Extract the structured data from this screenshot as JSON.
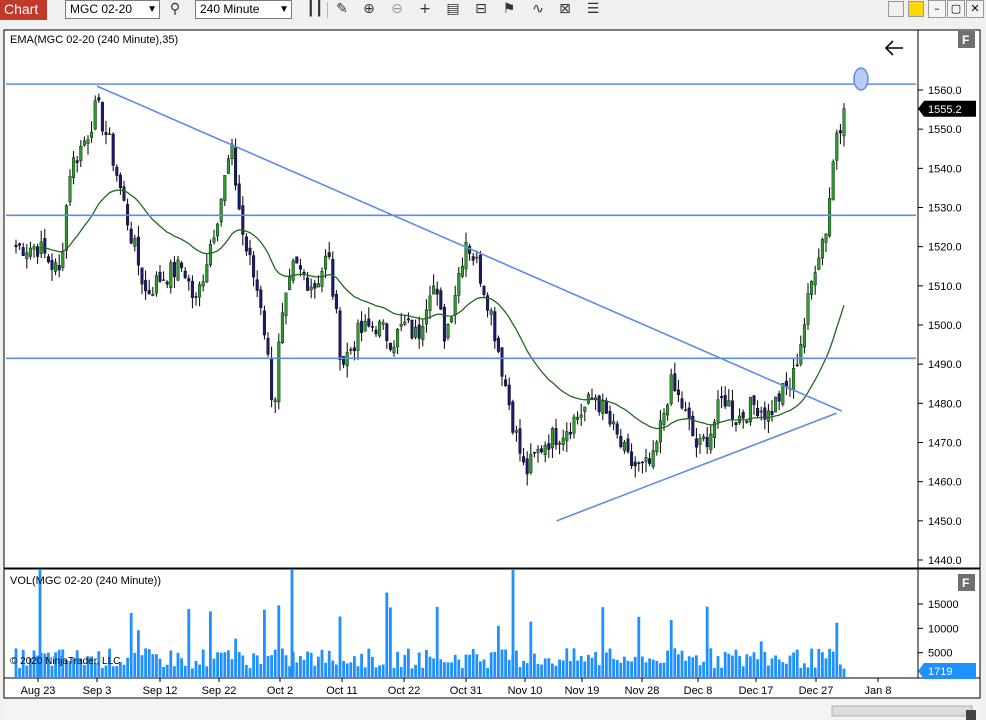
{
  "toolbar": {
    "tab_label": "Chart",
    "instrument": "MGC 02-20",
    "interval": "240 Minute",
    "icons": [
      "magnifier-icon",
      "bar-type-icon",
      "pencil-icon",
      "zoom-in-icon",
      "zoom-out-icon",
      "crosshair-icon",
      "properties-icon",
      "data-box-icon",
      "strategy-icon",
      "indicators-icon",
      "list-icon"
    ]
  },
  "window": {
    "swatches": [
      "#f0f0f0",
      "#ffd700"
    ],
    "buttons": [
      "–",
      "▢",
      "✕"
    ]
  },
  "price_panel": {
    "indicator_label": "EMA(MGC 02-20 (240 Minute),35)",
    "y_ticks": [
      "1560.0",
      "1550.0",
      "1540.0",
      "1530.0",
      "1520.0",
      "1510.0",
      "1500.0",
      "1490.0",
      "1480.0",
      "1470.0",
      "1460.0",
      "1450.0",
      "1440.0"
    ],
    "last_price": "1555.2",
    "panel_button": "F",
    "colors": {
      "line": "#5b8de8",
      "ema": "#1e6b1e",
      "up": "#2aa02a",
      "down": "#1a1a6e",
      "last_price_bg": "#000000"
    }
  },
  "volume_panel": {
    "indicator_label": "VOL(MGC 02-20 (240 Minute))",
    "y_ticks": [
      "15000",
      "10000",
      "5000"
    ],
    "last_volume": "1719",
    "panel_button": "F",
    "copyright": "© 2020 NinjaTrader, LLC",
    "bar_color": "#1e90ff"
  },
  "x_axis": {
    "labels": [
      "Aug 23",
      "Sep 3",
      "Sep 12",
      "Sep 22",
      "Oct 2",
      "Oct 11",
      "Oct 22",
      "Oct 31",
      "Nov 10",
      "Nov 19",
      "Nov 28",
      "Dec 8",
      "Dec 17",
      "Dec 27",
      "Jan 8"
    ]
  },
  "chart_data": {
    "type": "candlestick",
    "x": [
      "Aug 23",
      "Sep 3",
      "Sep 12",
      "Sep 22",
      "Oct 2",
      "Oct 11",
      "Oct 22",
      "Oct 31",
      "Nov 10",
      "Nov 19",
      "Nov 28",
      "Dec 8",
      "Dec 17",
      "Dec 27",
      "Jan 8"
    ],
    "close_path": [
      {
        "x": "Aug 23",
        "y": 1520
      },
      {
        "x": "Aug 27",
        "y": 1513
      },
      {
        "x": "Aug 29",
        "y": 1540
      },
      {
        "x": "Sep 1",
        "y": 1548
      },
      {
        "x": "Sep 3",
        "y": 1556
      },
      {
        "x": "Sep 5",
        "y": 1545
      },
      {
        "x": "Sep 8",
        "y": 1522
      },
      {
        "x": "Sep 10",
        "y": 1508
      },
      {
        "x": "Sep 12",
        "y": 1512
      },
      {
        "x": "Sep 16",
        "y": 1515
      },
      {
        "x": "Sep 18",
        "y": 1505
      },
      {
        "x": "Sep 22",
        "y": 1530
      },
      {
        "x": "Sep 24",
        "y": 1545
      },
      {
        "x": "Sep 26",
        "y": 1522
      },
      {
        "x": "Sep 29",
        "y": 1505
      },
      {
        "x": "Oct 1",
        "y": 1478
      },
      {
        "x": "Oct 2",
        "y": 1498
      },
      {
        "x": "Oct 4",
        "y": 1515
      },
      {
        "x": "Oct 7",
        "y": 1510
      },
      {
        "x": "Oct 9",
        "y": 1518
      },
      {
        "x": "Oct 11",
        "y": 1490
      },
      {
        "x": "Oct 14",
        "y": 1498
      },
      {
        "x": "Oct 17",
        "y": 1500
      },
      {
        "x": "Oct 20",
        "y": 1496
      },
      {
        "x": "Oct 22",
        "y": 1500
      },
      {
        "x": "Oct 24",
        "y": 1497
      },
      {
        "x": "Oct 26",
        "y": 1512
      },
      {
        "x": "Oct 28",
        "y": 1497
      },
      {
        "x": "Oct 31",
        "y": 1522
      },
      {
        "x": "Nov 2",
        "y": 1515
      },
      {
        "x": "Nov 4",
        "y": 1505
      },
      {
        "x": "Nov 6",
        "y": 1490
      },
      {
        "x": "Nov 8",
        "y": 1475
      },
      {
        "x": "Nov 10",
        "y": 1462
      },
      {
        "x": "Nov 13",
        "y": 1470
      },
      {
        "x": "Nov 16",
        "y": 1473
      },
      {
        "x": "Nov 19",
        "y": 1478
      },
      {
        "x": "Nov 21",
        "y": 1482
      },
      {
        "x": "Nov 24",
        "y": 1472
      },
      {
        "x": "Nov 26",
        "y": 1465
      },
      {
        "x": "Nov 28",
        "y": 1463
      },
      {
        "x": "Nov 30",
        "y": 1465
      },
      {
        "x": "Dec 3",
        "y": 1485
      },
      {
        "x": "Dec 5",
        "y": 1480
      },
      {
        "x": "Dec 8",
        "y": 1468
      },
      {
        "x": "Dec 10",
        "y": 1473
      },
      {
        "x": "Dec 12",
        "y": 1482
      },
      {
        "x": "Dec 14",
        "y": 1476
      },
      {
        "x": "Dec 17",
        "y": 1480
      },
      {
        "x": "Dec 19",
        "y": 1477
      },
      {
        "x": "Dec 21",
        "y": 1482
      },
      {
        "x": "Dec 23",
        "y": 1485
      },
      {
        "x": "Dec 25",
        "y": 1500
      },
      {
        "x": "Dec 27",
        "y": 1517
      },
      {
        "x": "Dec 29",
        "y": 1525
      },
      {
        "x": "Dec 31",
        "y": 1550
      },
      {
        "x": "Jan 2",
        "y": 1555.2
      }
    ],
    "ema_period": 35,
    "last_price": 1555.2,
    "horizontal_lines": [
      1561.5,
      1528,
      1491.5
    ],
    "trend_lines": [
      {
        "from": {
          "x": "Sep 3",
          "y": 1561
        },
        "to": {
          "x": "Jan 1",
          "y": 1478
        }
      },
      {
        "from": {
          "x": "Nov 15",
          "y": 1450
        },
        "to": {
          "x": "Dec 31",
          "y": 1477.5
        }
      }
    ],
    "volume": {
      "typical": 3500,
      "peak": 22000,
      "last": 1719
    },
    "y_range": [
      1440,
      1563
    ],
    "volume_range": [
      0,
      22000
    ]
  }
}
